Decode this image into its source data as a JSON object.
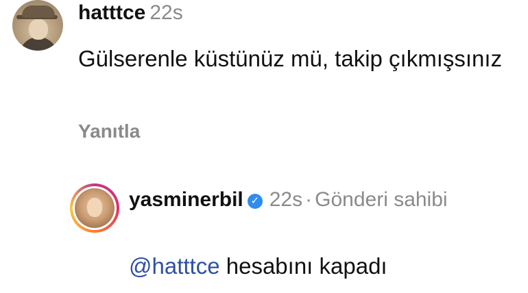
{
  "comment": {
    "username": "hatttce",
    "time": "22s",
    "text": "Gülserenle küstünüz mü, takip çıkmışsınız",
    "reply_label": "Yanıtla"
  },
  "reply": {
    "username": "yasminerbil",
    "verified_icon": "verified-badge-icon",
    "time": "22s",
    "separator": "·",
    "owner_label": "Gönderi sahibi",
    "mention": "@hatttce",
    "text": "hesabını kapadı"
  },
  "colors": {
    "mention": "#2e4fa3",
    "verified": "#2f8cf0",
    "secondary_text": "#8a8a8a"
  }
}
